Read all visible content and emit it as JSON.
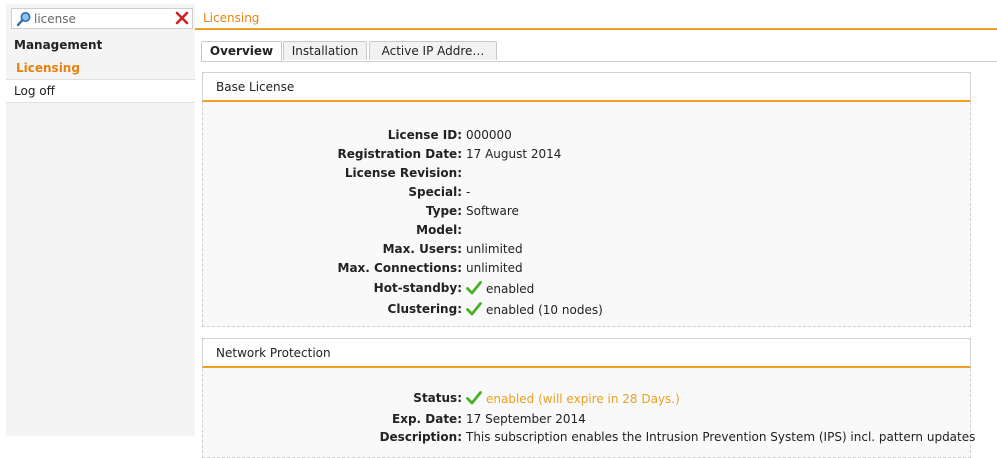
{
  "search": {
    "value": "license",
    "placeholder": ""
  },
  "sidebar": {
    "items": [
      {
        "label": "Management"
      },
      {
        "label": "Licensing"
      },
      {
        "label": "Log off"
      }
    ]
  },
  "main": {
    "title": "Licensing",
    "tabs": [
      {
        "label": "Overview",
        "active": true
      },
      {
        "label": "Installation",
        "active": false
      },
      {
        "label": "Active IP Addre…",
        "active": false
      }
    ]
  },
  "base_license": {
    "title": "Base License",
    "rows": [
      {
        "label": "License ID:",
        "value": "000000"
      },
      {
        "label": "Registration Date:",
        "value": "17 August 2014"
      },
      {
        "label": "License Revision:",
        "value": ""
      },
      {
        "label": "Special:",
        "value": "-"
      },
      {
        "label": "Type:",
        "value": "Software"
      },
      {
        "label": "Model:",
        "value": ""
      },
      {
        "label": "Max. Users:",
        "value": "unlimited"
      },
      {
        "label": "Max. Connections:",
        "value": "unlimited"
      },
      {
        "label": "Hot-standby:",
        "value": "enabled",
        "icon": "check-icon"
      },
      {
        "label": "Clustering:",
        "value": "enabled (10 nodes)",
        "icon": "check-icon"
      }
    ]
  },
  "network_protection": {
    "title": "Network Protection",
    "rows": [
      {
        "label": "Status:",
        "value": "enabled (will expire in 28 Days.)",
        "icon": "check-icon"
      },
      {
        "label": "Exp. Date:",
        "value": "17 September 2014"
      },
      {
        "label": "Description:",
        "value": "This subscription enables the Intrusion Prevention System (IPS) incl. pattern updates"
      }
    ]
  },
  "colors": {
    "accent": "#e8820c",
    "underline": "#f0a020",
    "check": "#4caf2a",
    "close": "#cc2222"
  },
  "icons": {
    "search": "search-icon",
    "clear": "close-icon",
    "check": "check-icon"
  }
}
